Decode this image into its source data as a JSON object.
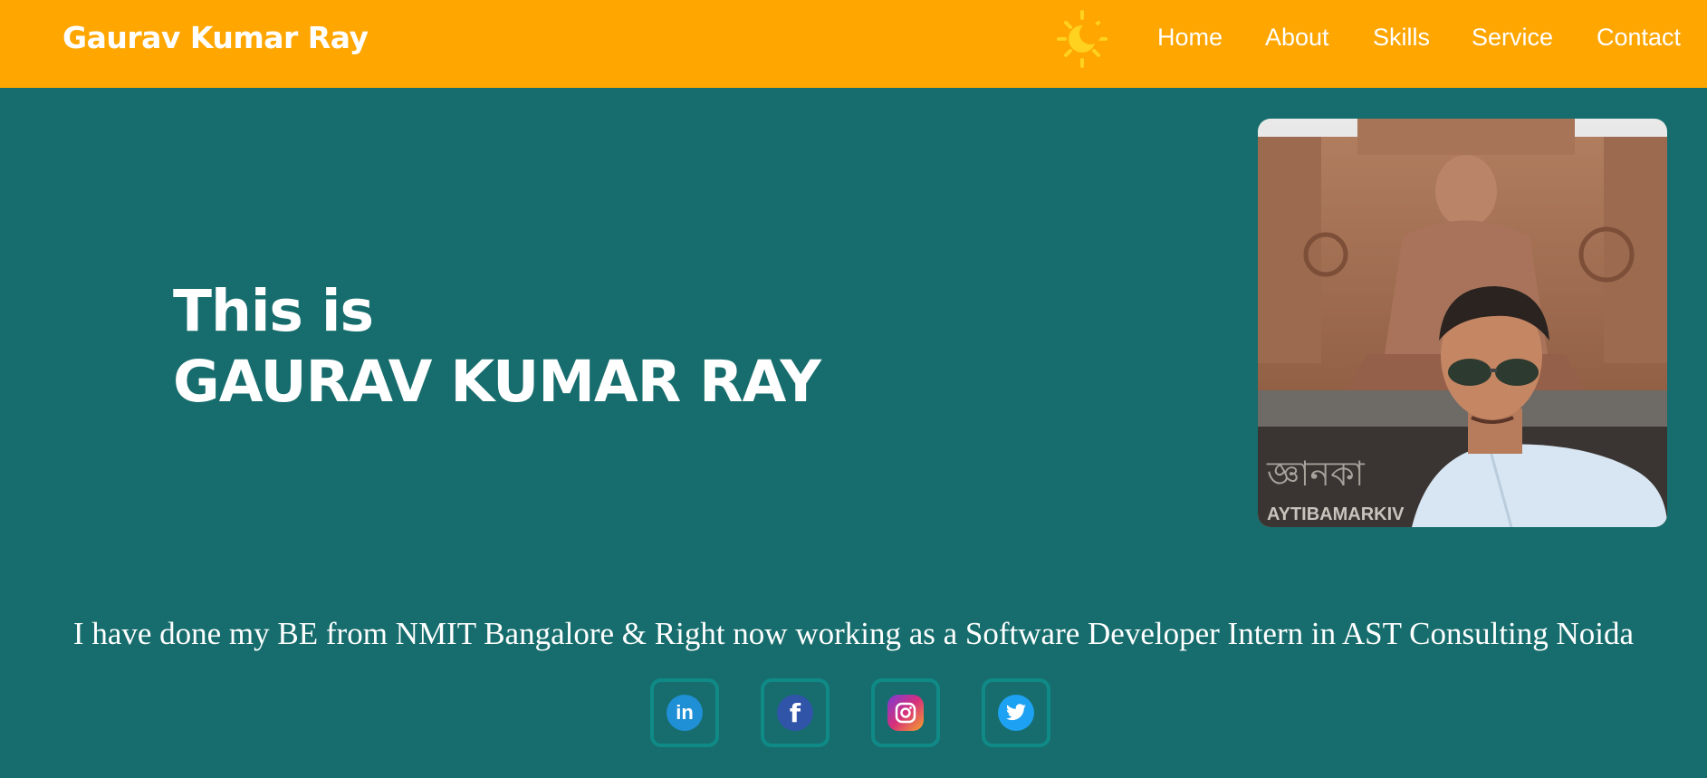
{
  "header": {
    "brand": "Gaurav Kumar Ray",
    "theme_icon": "sun-icon",
    "nav": {
      "home": "Home",
      "about": "About",
      "skills": "Skills",
      "service": "Service",
      "contact": "Contact"
    }
  },
  "hero": {
    "line1": "This is",
    "line2": "GAURAV KUMAR RAY",
    "photo_icon": "profile-photo"
  },
  "bio": "I have done my BE from NMIT Bangalore & Right now working as a Software Developer Intern in AST Consulting Noida",
  "socials": {
    "linkedin": "linkedin-icon",
    "facebook": "facebook-icon",
    "instagram": "instagram-icon",
    "twitter": "twitter-icon"
  },
  "colors": {
    "navbar": "#ffa600",
    "background": "#176d6d",
    "social_border": "#0f8a86"
  }
}
